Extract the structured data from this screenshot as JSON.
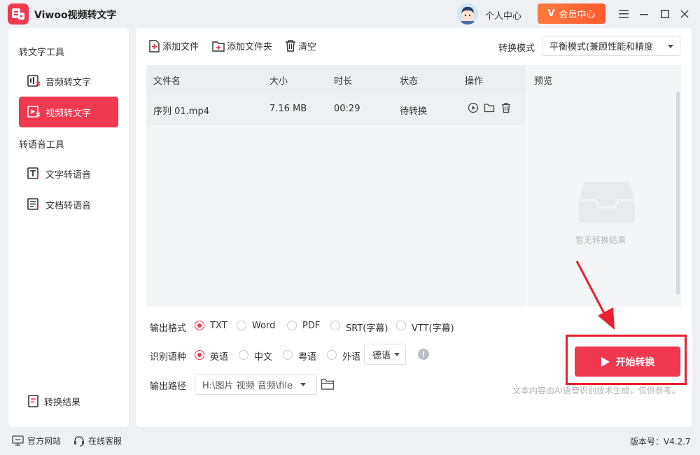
{
  "titlebar": {
    "app_title": "Viwoo视频转文字",
    "profile_label": "个人中心",
    "vip_label": "会员中心",
    "vip_badge": "V"
  },
  "sidebar": {
    "section_text_tools": "转文字工具",
    "item_audio": "音频转文字",
    "item_video": "视频转文字",
    "section_speech_tools": "转语音工具",
    "item_text_speech": "文字转语音",
    "item_doc_speech": "文档转语音",
    "item_results": "转换结果"
  },
  "toolbar": {
    "add_file": "添加文件",
    "add_folder": "添加文件夹",
    "clear": "清空",
    "mode_label": "转换模式",
    "mode_value": "平衡模式(兼顾性能和精度"
  },
  "table": {
    "headers": {
      "name": "文件名",
      "size": "大小",
      "duration": "时长",
      "status": "状态",
      "actions": "操作"
    },
    "rows": [
      {
        "name": "序列 01.mp4",
        "size": "7.16 MB",
        "duration": "00:29",
        "status": "待转换"
      }
    ]
  },
  "preview": {
    "title": "预览",
    "empty_text": "暂无转换结果"
  },
  "options": {
    "format_label": "输出格式",
    "formats": [
      "TXT",
      "Word",
      "PDF",
      "SRT(字幕)",
      "VTT(字幕)"
    ],
    "selected_format": "TXT",
    "lang_label": "识别语种",
    "langs": [
      "英语",
      "中文",
      "粤语",
      "外语"
    ],
    "selected_lang": "英语",
    "foreign_lang_value": "德语",
    "info_glyph": "!",
    "path_label": "输出路径",
    "path_value": "H:\\图片 视频 音频\\file"
  },
  "action": {
    "start_label": "开始转换",
    "disclaimer": "文本内容由AI语音识别技术生成，仅供参考。"
  },
  "footer": {
    "website": "官方网站",
    "support": "在线客服",
    "version": "版本号：V4.2.7"
  },
  "colors": {
    "accent": "#f0384f",
    "vip": "#ff6a33",
    "highlight_frame": "#e8202f"
  }
}
